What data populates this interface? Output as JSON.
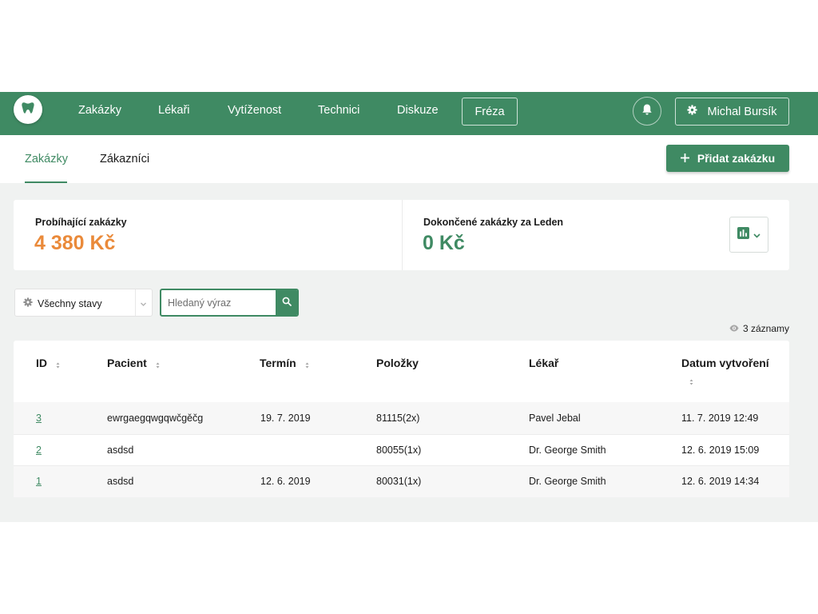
{
  "colors": {
    "brand": "#3f8a63",
    "accent_orange": "#ea8a3a",
    "content_bg": "#f0f2f1"
  },
  "nav": {
    "logo_icon": "tooth-icon",
    "items": [
      "Zakázky",
      "Lékaři",
      "Vytíženost",
      "Technici",
      "Diskuze"
    ],
    "boxed_item": "Fréza",
    "bell_icon": "bell-icon",
    "user": {
      "icon": "gear-icon",
      "name": "Michal Bursík"
    }
  },
  "subnav": {
    "tabs": [
      {
        "label": "Zakázky",
        "active": true
      },
      {
        "label": "Zákazníci",
        "active": false
      }
    ],
    "add_button": {
      "icon": "plus-icon",
      "label": "Přidat zakázku"
    }
  },
  "stats": {
    "ongoing": {
      "label": "Probíhající zakázky",
      "value": "4 380 Kč"
    },
    "completed": {
      "label": "Dokončené zakázky za Leden",
      "value": "0 Kč"
    },
    "chart_button_icon": "bar-chart-icon"
  },
  "filters": {
    "status": {
      "icon": "gear-icon",
      "selected": "Všechny stavy"
    },
    "search": {
      "placeholder": "Hledaný výraz",
      "value": "",
      "icon": "search-icon"
    }
  },
  "records": {
    "icon": "eye-icon",
    "text": "3 záznamy"
  },
  "table": {
    "columns": [
      {
        "label": "ID",
        "sortable": true
      },
      {
        "label": "Pacient",
        "sortable": true
      },
      {
        "label": "Termín",
        "sortable": true
      },
      {
        "label": "Položky",
        "sortable": false
      },
      {
        "label": "Lékař",
        "sortable": false
      },
      {
        "label": "Datum vytvoření",
        "sortable": true
      }
    ],
    "rows": [
      {
        "id": "3",
        "patient": "ewrgaegqwgqwčgěčg",
        "term": "19. 7. 2019",
        "items": "81115(2x)",
        "doctor": "Pavel Jebal",
        "created": "11. 7. 2019 12:49"
      },
      {
        "id": "2",
        "patient": "asdsd",
        "term": "",
        "items": "80055(1x)",
        "doctor": "Dr. George Smith",
        "created": "12. 6. 2019 15:09"
      },
      {
        "id": "1",
        "patient": "asdsd",
        "term": "12. 6. 2019",
        "items": "80031(1x)",
        "doctor": "Dr. George Smith",
        "created": "12. 6. 2019 14:34"
      }
    ]
  }
}
